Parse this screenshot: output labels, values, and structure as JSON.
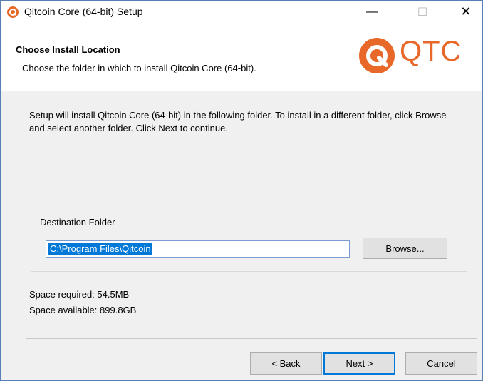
{
  "window": {
    "title": "Qitcoin Core (64-bit) Setup",
    "controls": {
      "minimize": "—",
      "maximize": "☐",
      "close": "✕"
    }
  },
  "header": {
    "title": "Choose Install Location",
    "subtitle": "Choose the folder in which to install Qitcoin Core (64-bit).",
    "logo_text": "QTC",
    "brand_color": "#e8682a"
  },
  "body": {
    "intro": "Setup will install Qitcoin Core (64-bit) in the following folder. To install in a different folder, click Browse and select another folder. Click Next to continue.",
    "destination": {
      "legend": "Destination Folder",
      "path": "C:\\Program Files\\Qitcoin",
      "browse_label": "Browse..."
    },
    "space_required": "Space required: 54.5MB",
    "space_available": "Space available: 899.8GB"
  },
  "footer": {
    "back_label": "< Back",
    "next_label": "Next >",
    "cancel_label": "Cancel"
  }
}
